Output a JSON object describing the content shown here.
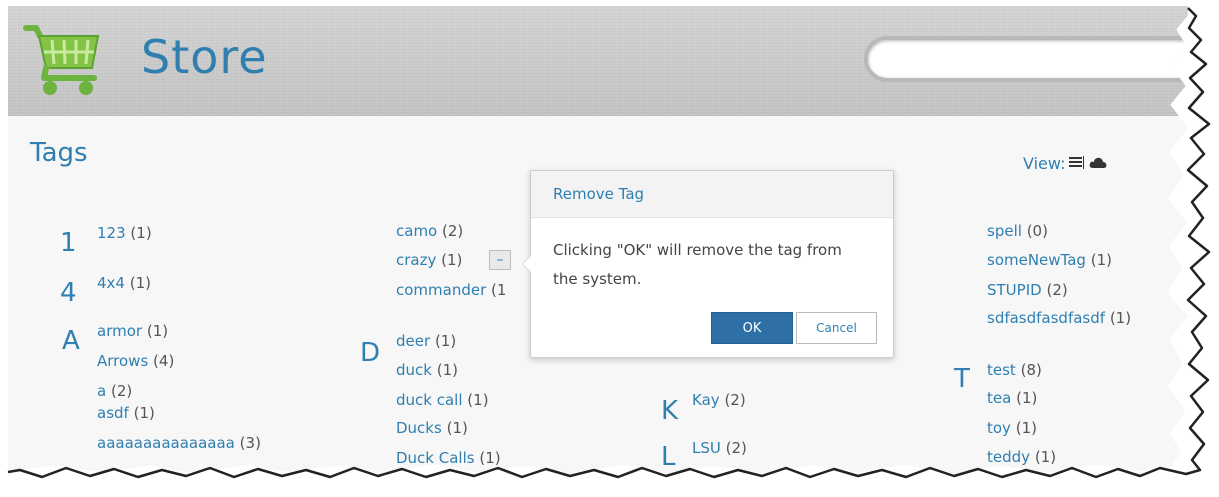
{
  "header": {
    "brand": "Store",
    "search_placeholder": ""
  },
  "page_title": "Tags",
  "view": {
    "label": "View:",
    "list_icon": "list-icon",
    "cloud_icon": "cloud-icon"
  },
  "groups": {
    "g1": "1",
    "g4": "4",
    "gA": "A",
    "gD": "D",
    "gK": "K",
    "gL": "L",
    "gT": "T"
  },
  "tags": {
    "t123": {
      "name": "123",
      "count": "(1)"
    },
    "t4x4": {
      "name": "4x4",
      "count": "(1)"
    },
    "armor": {
      "name": "armor",
      "count": "(1)"
    },
    "arrows": {
      "name": "Arrows",
      "count": "(4)"
    },
    "a": {
      "name": "a",
      "count": "(2)"
    },
    "asdf": {
      "name": "asdf",
      "count": "(1)"
    },
    "aaaa": {
      "name": "aaaaaaaaaaaaaaa",
      "count": "(3)"
    },
    "camo": {
      "name": "camo",
      "count": "(2)"
    },
    "crazy": {
      "name": "crazy",
      "count": "(1)"
    },
    "commander": {
      "name": "commander",
      "count": "(1"
    },
    "deer": {
      "name": "deer",
      "count": "(1)"
    },
    "duck": {
      "name": "duck",
      "count": "(1)"
    },
    "duckcall": {
      "name": "duck call",
      "count": "(1)"
    },
    "ducks": {
      "name": "Ducks",
      "count": "(1)"
    },
    "duckcalls": {
      "name": "Duck Calls",
      "count": "(1)"
    },
    "kay": {
      "name": "Kay",
      "count": "(2)"
    },
    "lsu": {
      "name": "LSU",
      "count": "(2)"
    },
    "spell": {
      "name": "spell",
      "count": "(0)"
    },
    "somenewtag": {
      "name": "someNewTag",
      "count": "(1)"
    },
    "stupid": {
      "name": "STUPID",
      "count": "(2)"
    },
    "sdfas": {
      "name": "sdfasdfasdfasdf",
      "count": "(1)"
    },
    "test": {
      "name": "test",
      "count": "(8)"
    },
    "tea": {
      "name": "tea",
      "count": "(1)"
    },
    "toy": {
      "name": "toy",
      "count": "(1)"
    },
    "teddy": {
      "name": "teddy",
      "count": "(1)"
    }
  },
  "remove_button": "–",
  "popover": {
    "title": "Remove Tag",
    "message": "Clicking \"OK\" will remove the tag from the system.",
    "ok_label": "OK",
    "cancel_label": "Cancel"
  },
  "colors": {
    "accent": "#2f7fb0",
    "header": "#cccccc",
    "ok_button": "#2d6fa6",
    "logo_green": "#7cc243"
  }
}
